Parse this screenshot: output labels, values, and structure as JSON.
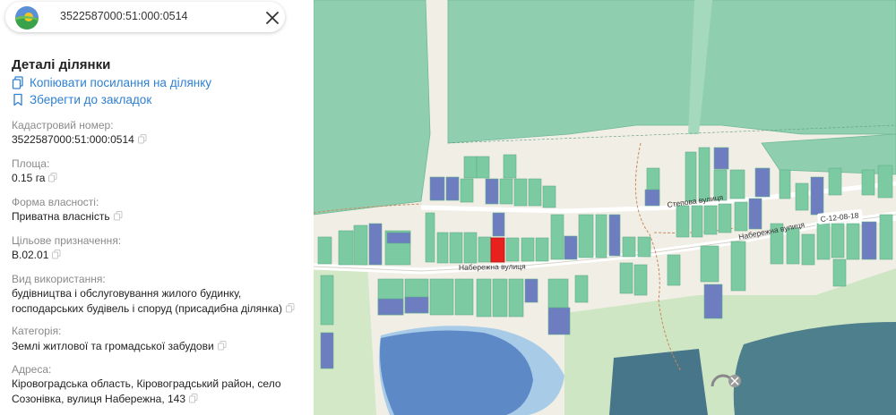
{
  "search": {
    "cadastral_number": "3522587000:51:000:0514"
  },
  "details": {
    "title": "Деталі ділянки",
    "copy_link": "Копіювати посилання на ділянку",
    "bookmark": "Зберегти до закладок",
    "fields": {
      "cadastral": {
        "label": "Кадастровий номер:",
        "value": "3522587000:51:000:0514"
      },
      "area": {
        "label": "Площа:",
        "value": "0.15 га"
      },
      "ownership": {
        "label": "Форма власності:",
        "value": "Приватна власність"
      },
      "purpose": {
        "label": "Цільове призначення:",
        "value": "В.02.01"
      },
      "usage": {
        "label": "Вид використання:",
        "line1": "будівництва і обслуговування жилого будинку,",
        "line2": "господарських будівель і споруд (присадибна ділянка)"
      },
      "category": {
        "label": "Категорія:",
        "value": "Землі житлової та громадської забудови"
      },
      "address": {
        "label": "Адреса:",
        "line1": "Кіровоградська область, Кіровоградський район, село",
        "line2": "Созонівка, вулиця Набережна, 143"
      }
    }
  },
  "map": {
    "streets": {
      "main": "Набережна вулиця",
      "east": "Набережна вулиця",
      "north": "Степова вулиця",
      "road_code": "С-12-08-18"
    },
    "colors": {
      "field": "#8fcfb0",
      "parcel": "#7ccaa2",
      "state_parcel": "#6d7dc0",
      "selected": "#e8201e",
      "water": "#4f7fc4",
      "forest": "#a9d9a4"
    }
  }
}
